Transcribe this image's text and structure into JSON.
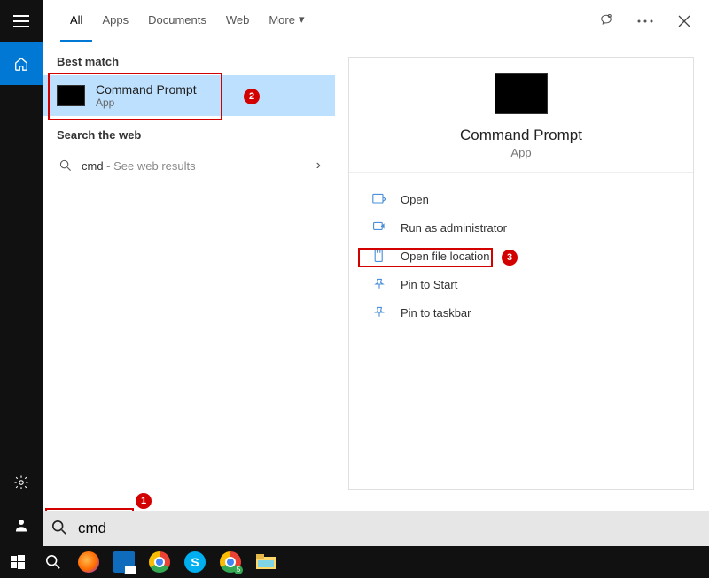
{
  "tabs": {
    "all": "All",
    "apps": "Apps",
    "documents": "Documents",
    "web": "Web",
    "more": "More"
  },
  "sections": {
    "best_match": "Best match",
    "search_web": "Search the web"
  },
  "result": {
    "title": "Command Prompt",
    "subtitle": "App"
  },
  "web_result": {
    "term": "cmd",
    "hint": " - See web results"
  },
  "preview": {
    "title": "Command Prompt",
    "subtitle": "App",
    "actions": {
      "open": "Open",
      "run_admin": "Run as administrator",
      "open_loc": "Open file location",
      "pin_start": "Pin to Start",
      "pin_taskbar": "Pin to taskbar"
    }
  },
  "search": {
    "value": "cmd"
  },
  "annotations": {
    "badge1": "1",
    "badge2": "2",
    "badge3": "3"
  },
  "colors": {
    "accent": "#0078d4",
    "annotation": "#d30000",
    "selected": "#bde0fe"
  }
}
